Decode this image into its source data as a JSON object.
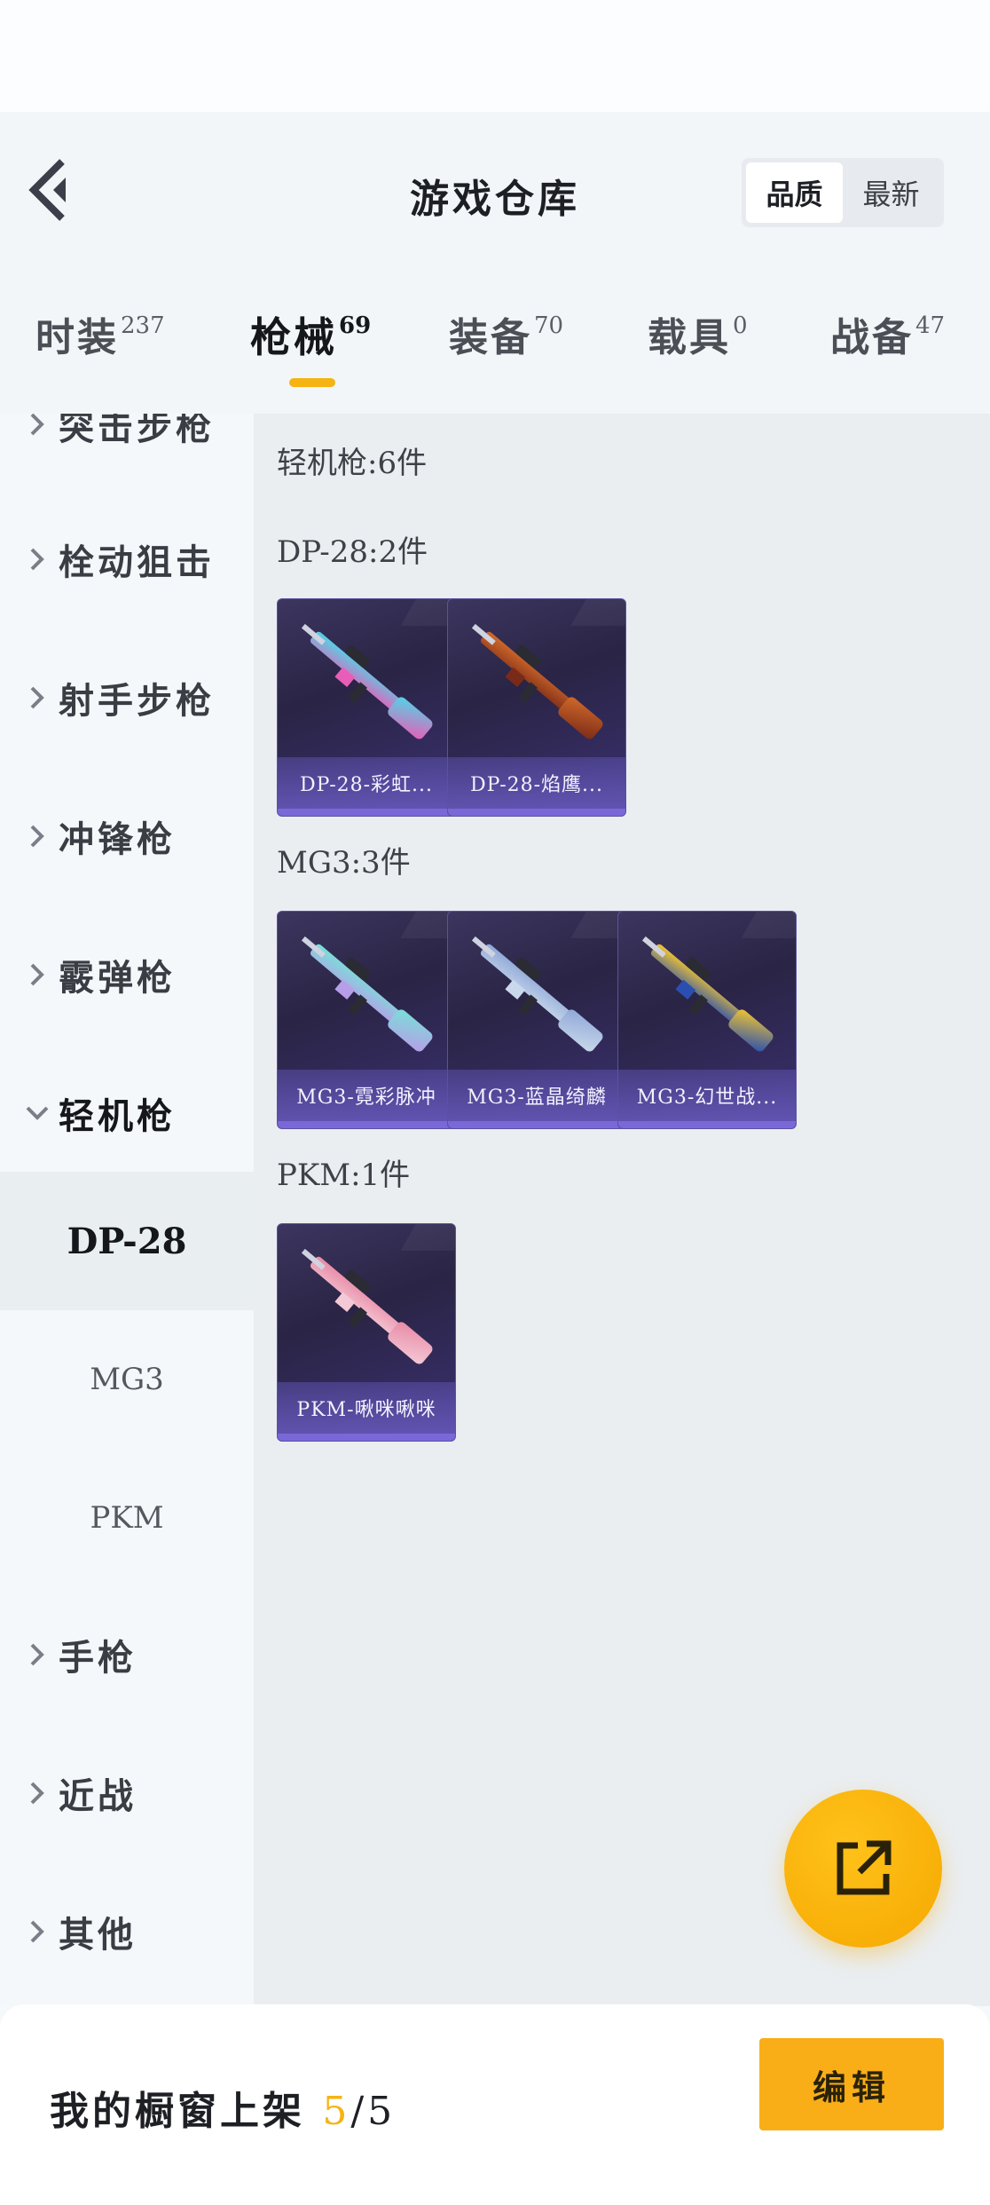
{
  "header": {
    "title": "游戏仓库",
    "sort_options": [
      "品质",
      "最新"
    ],
    "active_sort": "品质"
  },
  "tabs": [
    {
      "label": "时装",
      "count": "237"
    },
    {
      "label": "枪械",
      "count": "69"
    },
    {
      "label": "装备",
      "count": "70"
    },
    {
      "label": "载具",
      "count": "0"
    },
    {
      "label": "战备",
      "count": "47"
    }
  ],
  "sidebar": {
    "partial_top": "突击步枪",
    "categories": [
      "栓动狙击",
      "射手步枪",
      "冲锋枪",
      "霰弹枪",
      "轻机枪"
    ],
    "subitems": [
      "DP-28",
      "MG3",
      "PKM"
    ],
    "bottom_categories": [
      "手枪",
      "近战",
      "其他"
    ]
  },
  "content": {
    "section_title": "轻机枪:6件",
    "groups": [
      {
        "title": "DP-28:2件",
        "items": [
          {
            "label": "DP-28-彩虹...",
            "colors": [
              "#e85db8",
              "#4fd6e8"
            ]
          },
          {
            "label": "DP-28-焰鹰...",
            "colors": [
              "#7a2a18",
              "#d26a2a"
            ]
          }
        ]
      },
      {
        "title": "MG3:3件",
        "items": [
          {
            "label": "MG3-霓彩脉冲",
            "colors": [
              "#b79ee8",
              "#78e0d8"
            ]
          },
          {
            "label": "MG3-蓝晶绮麟",
            "colors": [
              "#c9d8ea",
              "#8fa8d8"
            ]
          },
          {
            "label": "MG3-幻世战...",
            "colors": [
              "#2b4fb0",
              "#f2c630"
            ]
          }
        ]
      },
      {
        "title": "PKM:1件",
        "items": [
          {
            "label": "PKM-啾咪啾咪",
            "colors": [
              "#f4c9d6",
              "#e88aa6"
            ]
          }
        ]
      }
    ]
  },
  "bottom": {
    "prefix": "我的橱窗上架",
    "count": "5",
    "total": "/5",
    "edit_label": "编辑"
  },
  "colors": {
    "accent": "#f5b412",
    "card_bg": "#2a2445"
  }
}
